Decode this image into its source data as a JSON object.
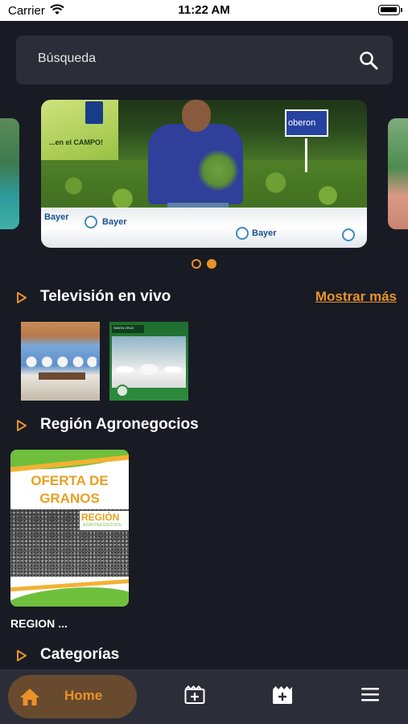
{
  "status_bar": {
    "carrier": "Carrier",
    "time": "11:22 AM"
  },
  "search": {
    "placeholder": "Búsqueda",
    "value": ""
  },
  "carousel": {
    "slides": [
      {
        "banner_text": "...en el CAMPO!",
        "sign_text": "oberon",
        "sponsor": "Bayer"
      }
    ],
    "page_count": 2,
    "active_index": 1
  },
  "sections": {
    "live_tv": {
      "title": "Televisión en vivo",
      "more_label": "Mostrar más",
      "thumb_2_header": "SANTA CRUZ"
    },
    "region": {
      "title": "Región Agronegocios",
      "card": {
        "offer_title": "OFERTA DE GRANOS",
        "logo": "REGIÓN",
        "logo_sub": "AGRONEGOCIOS",
        "caption": "REGION ..."
      }
    },
    "categories": {
      "title": "Categorías"
    }
  },
  "bottom_nav": {
    "home_label": "Home",
    "items": [
      "home-icon",
      "add-clip-icon",
      "add-film-icon",
      "menu-icon"
    ]
  },
  "colors": {
    "background": "#181b24",
    "surface": "#2b2e38",
    "accent": "#e9922a",
    "home_pill": "#684b2e"
  }
}
